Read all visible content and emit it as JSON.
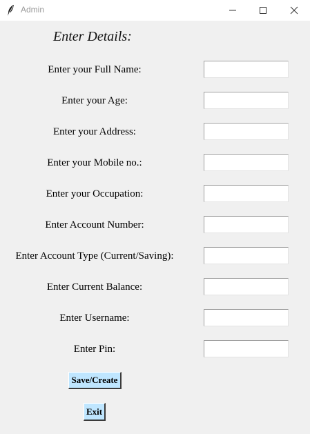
{
  "window": {
    "title": "Admin"
  },
  "form": {
    "heading": "Enter Details:",
    "fields": [
      {
        "label": "Enter your Full Name:",
        "value": ""
      },
      {
        "label": "Enter your Age:",
        "value": ""
      },
      {
        "label": "Enter your Address:",
        "value": ""
      },
      {
        "label": "Enter your Mobile no.:",
        "value": ""
      },
      {
        "label": "Enter your Occupation:",
        "value": ""
      },
      {
        "label": "Enter Account Number:",
        "value": ""
      },
      {
        "label": "Enter Account Type (Current/Saving):",
        "value": ""
      },
      {
        "label": "Enter Current Balance:",
        "value": ""
      },
      {
        "label": "Enter Username:",
        "value": ""
      },
      {
        "label": "Enter Pin:",
        "value": ""
      }
    ],
    "save_label": "Save/Create",
    "exit_label": "Exit"
  },
  "colors": {
    "window_bg": "#f0f0f0",
    "button_bg": "#bfe6ff",
    "titlebar_bg": "#ffffff"
  },
  "icons": {
    "app": "feather-icon",
    "minimize": "minimize-icon",
    "maximize": "maximize-icon",
    "close": "close-icon"
  }
}
